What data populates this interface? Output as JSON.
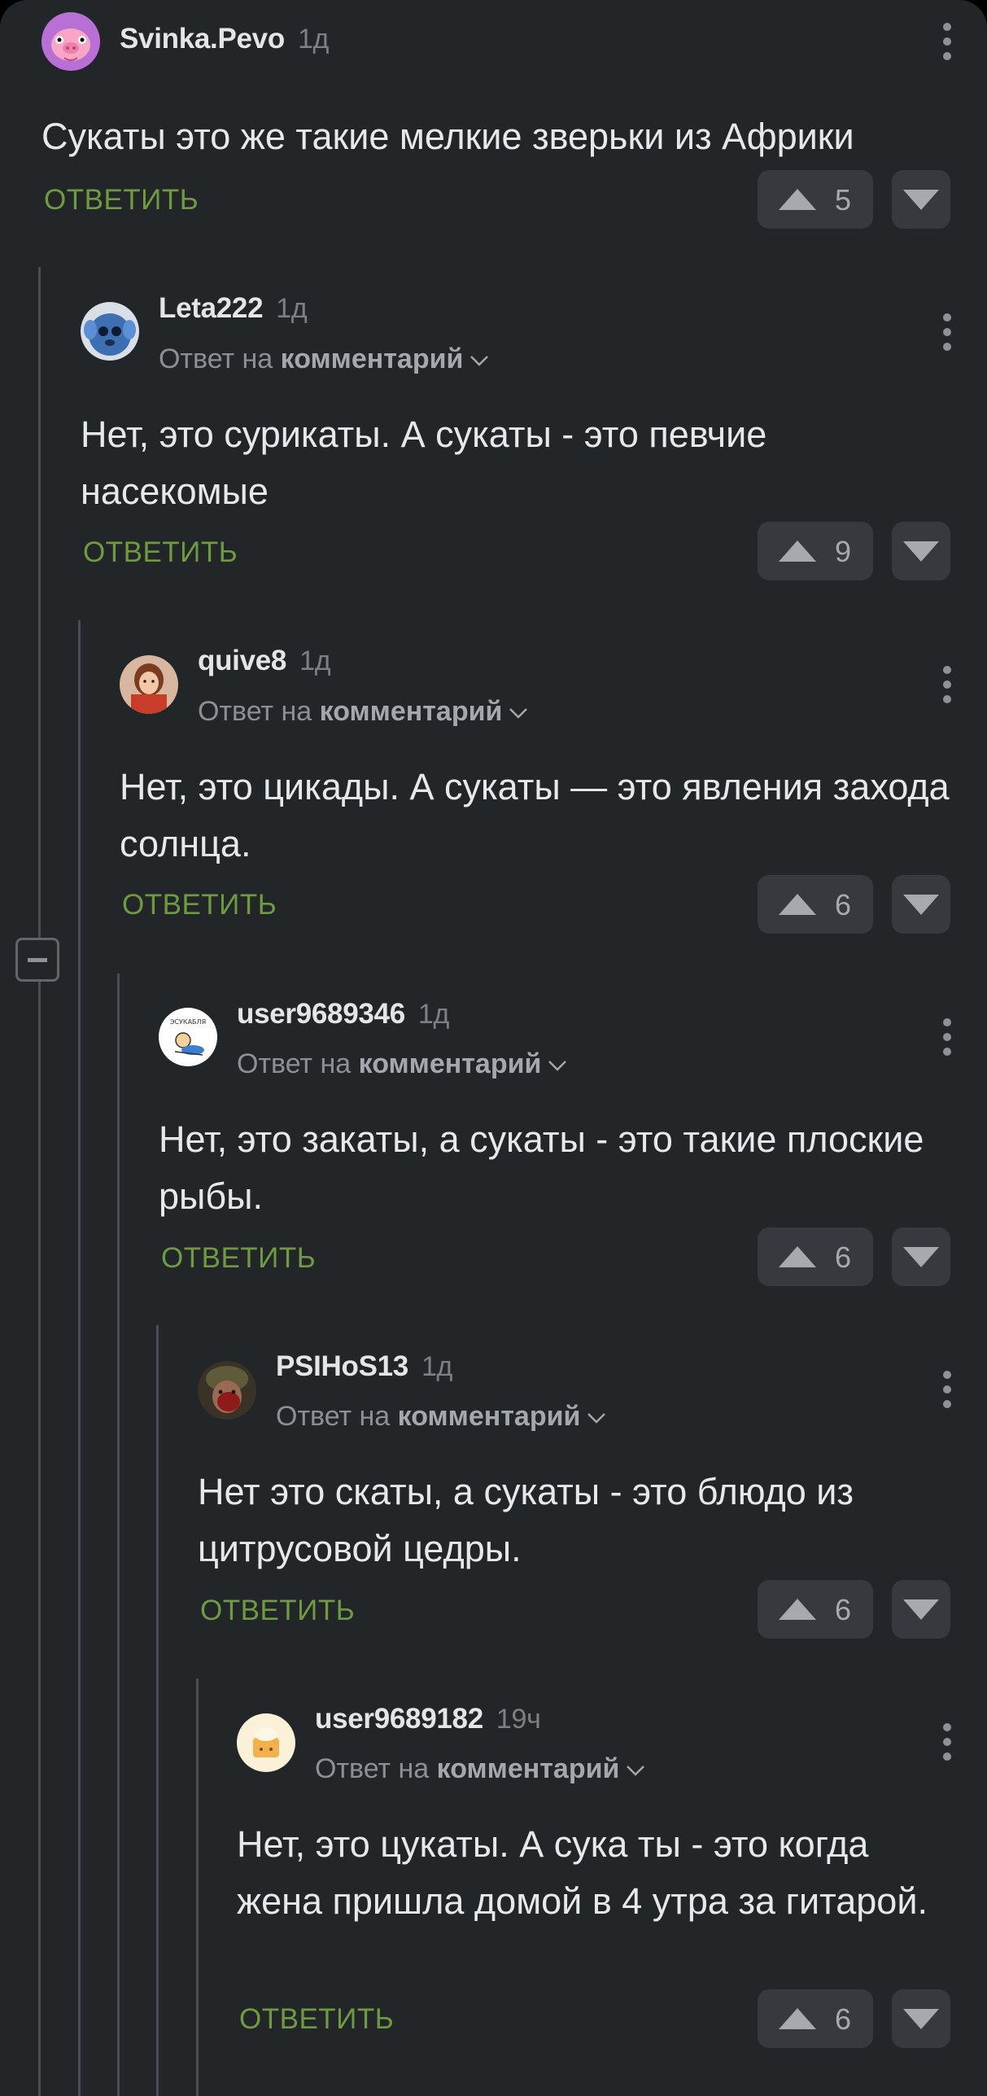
{
  "comments": [
    {
      "author": "Svinka.Pevo",
      "time": "1д",
      "reply_prefix": "",
      "reply_target": "",
      "text": "Сукаты это же такие мелкие зверьки из Африки",
      "reply_label": "ОТВЕТИТЬ",
      "votes": "5"
    },
    {
      "author": "Leta222",
      "time": "1д",
      "reply_prefix": "Ответ на",
      "reply_target": "комментарий",
      "text": "Нет, это сурикаты. А сукаты - это певчие насекомые",
      "reply_label": "ОТВЕТИТЬ",
      "votes": "9"
    },
    {
      "author": "quive8",
      "time": "1д",
      "reply_prefix": "Ответ на",
      "reply_target": "комментарий",
      "text": "Нет, это цикады. А сукаты — это явления захода солнца.",
      "reply_label": "ОТВЕТИТЬ",
      "votes": "6"
    },
    {
      "author": "user9689346",
      "time": "1д",
      "reply_prefix": "Ответ на",
      "reply_target": "комментарий",
      "text": "Нет, это закаты, а сукаты - это такие плоские рыбы.",
      "reply_label": "ОТВЕТИТЬ",
      "votes": "6"
    },
    {
      "author": "PSIHoS13",
      "time": "1д",
      "reply_prefix": "Ответ на",
      "reply_target": "комментарий",
      "text": "Нет это скаты, а сукаты - это блюдо из цитрусовой цедры.",
      "reply_label": "ОТВЕТИТЬ",
      "votes": "6"
    },
    {
      "author": "user9689182",
      "time": "19ч",
      "reply_prefix": "Ответ на",
      "reply_target": "комментарий",
      "text": "Нет, это цукаты. А сука ты - это когда жена пришла домой в 4 утра за гитарой.",
      "reply_label": "ОТВЕТИТЬ",
      "votes": "6"
    }
  ],
  "avatar_badge_text": "ЭСУКАБЛЯ",
  "colors": {
    "background": "#232629",
    "reply_accent": "#6e9b3f",
    "vote_button": "#36393d",
    "thread_line": "#4a4d52"
  },
  "icons": {
    "upvote": "triangle-up-icon",
    "downvote": "triangle-down-icon",
    "more": "vertical-dots-icon",
    "collapse": "minus-square-icon",
    "reply_expand": "chevron-down-icon"
  }
}
